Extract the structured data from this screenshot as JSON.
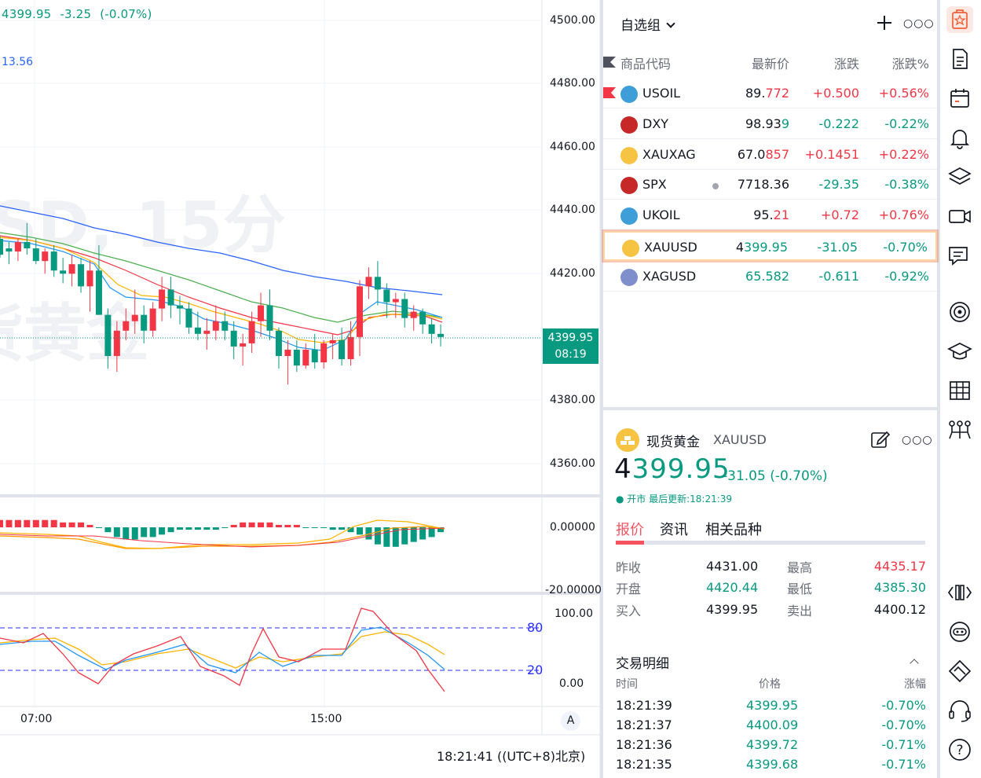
{
  "chart": {
    "header": {
      "price": "4399.95",
      "change": "-3.25",
      "change_pct": "(-0.07%)"
    },
    "ma_label": "13.56",
    "watermark_line1": "SD, 15分",
    "watermark_line2": "货黄金",
    "price_axis": [
      "4500.00",
      "4480.00",
      "4460.00",
      "4440.00",
      "4420.00",
      "4380.00",
      "4360.00"
    ],
    "current_tag": {
      "price": "4399.95",
      "countdown": "08:19"
    },
    "macd_axis": [
      "0.00000",
      "-20.00000"
    ],
    "kd_axis": [
      "100.00",
      "0.00"
    ],
    "kd_levels": [
      "80",
      "20"
    ],
    "time_axis": [
      "07:00",
      "15:00"
    ],
    "auto_label": "A",
    "clock": "18:21:41 ((UTC+8)北京)",
    "colors": {
      "up": "#f23645",
      "down": "#089981",
      "ma_blue": "#2962ff"
    }
  },
  "chart_data": {
    "type": "candlestick",
    "ylim": [
      4350,
      4505
    ],
    "candles": [
      [
        4431,
        4432,
        4425,
        4426
      ],
      [
        4428,
        4430,
        4423,
        4427
      ],
      [
        4427,
        4431,
        4424,
        4430
      ],
      [
        4430,
        4436,
        4426,
        4428
      ],
      [
        4428,
        4431,
        4423,
        4424
      ],
      [
        4424,
        4428,
        4420,
        4427
      ],
      [
        4427,
        4429,
        4419,
        4421
      ],
      [
        4421,
        4425,
        4417,
        4420
      ],
      [
        4420,
        4426,
        4416,
        4423
      ],
      [
        4423,
        4425,
        4414,
        4416
      ],
      [
        4416,
        4424,
        4408,
        4421
      ],
      [
        4421,
        4429,
        4414,
        4407
      ],
      [
        4407,
        4409,
        4390,
        4394
      ],
      [
        4394,
        4405,
        4389,
        4402
      ],
      [
        4402,
        4409,
        4399,
        4405
      ],
      [
        4405,
        4415,
        4401,
        4407
      ],
      [
        4407,
        4410,
        4398,
        4402
      ],
      [
        4402,
        4411,
        4400,
        4409
      ],
      [
        4409,
        4419,
        4405,
        4415
      ],
      [
        4415,
        4419,
        4406,
        4410
      ],
      [
        4410,
        4413,
        4404,
        4409
      ],
      [
        4409,
        4411,
        4401,
        4403
      ],
      [
        4403,
        4408,
        4399,
        4401
      ],
      [
        4401,
        4406,
        4396,
        4402
      ],
      [
        4402,
        4410,
        4399,
        4405
      ],
      [
        4405,
        4408,
        4399,
        4402
      ],
      [
        4402,
        4405,
        4393,
        4397
      ],
      [
        4397,
        4401,
        4391,
        4398
      ],
      [
        4398,
        4408,
        4395,
        4405
      ],
      [
        4405,
        4414,
        4400,
        4410
      ],
      [
        4410,
        4415,
        4399,
        4402
      ],
      [
        4402,
        4403,
        4390,
        4394
      ],
      [
        4394,
        4399,
        4385,
        4396
      ],
      [
        4396,
        4399,
        4389,
        4391
      ],
      [
        4391,
        4398,
        4390,
        4396
      ],
      [
        4396,
        4401,
        4390,
        4392
      ],
      [
        4392,
        4399,
        4390,
        4398
      ],
      [
        4398,
        4401,
        4393,
        4399
      ],
      [
        4399,
        4403,
        4391,
        4393
      ],
      [
        4393,
        4405,
        4391,
        4400
      ],
      [
        4400,
        4418,
        4394,
        4416
      ],
      [
        4416,
        4422,
        4412,
        4419
      ],
      [
        4419,
        4424,
        4410,
        4415
      ],
      [
        4415,
        4417,
        4406,
        4411
      ],
      [
        4411,
        4414,
        4406,
        4412
      ],
      [
        4412,
        4414,
        4403,
        4406
      ],
      [
        4406,
        4410,
        4402,
        4408
      ],
      [
        4408,
        4409,
        4401,
        4404
      ],
      [
        4404,
        4406,
        4398,
        4401
      ],
      [
        4401,
        4404,
        4397,
        4400
      ]
    ]
  },
  "watchlist": {
    "title": "自选组",
    "columns": {
      "symbol": "商品代码",
      "last": "最新价",
      "change": "涨跌",
      "change_pct": "涨跌%"
    },
    "rows": [
      {
        "symbol": "USOIL",
        "last_a": "89.",
        "last_b": "772",
        "change": "+0.500",
        "pct": "+0.56%",
        "dir": "up",
        "icon": "oil-drop-icon",
        "flag": true
      },
      {
        "symbol": "DXY",
        "last_a": "98.93",
        "last_b": "9",
        "change": "-0.222",
        "pct": "-0.22%",
        "dir": "dn",
        "icon": "us-flag-icon"
      },
      {
        "symbol": "XAUXAG",
        "last_a": "67.0",
        "last_b": "857",
        "change": "+0.1451",
        "pct": "+0.22%",
        "dir": "up",
        "icon": "gold-silver-icon"
      },
      {
        "symbol": "SPX",
        "last_a": "7718.36",
        "last_b": "",
        "change": "-29.35",
        "pct": "-0.38%",
        "dir": "dn",
        "icon": "us-flag-icon",
        "dot": true
      },
      {
        "symbol": "UKOIL",
        "last_a": "95.",
        "last_b": "21",
        "change": "+0.72",
        "pct": "+0.76%",
        "dir": "up",
        "icon": "oil-drop-icon"
      },
      {
        "symbol": "XAUUSD",
        "last_a": "4",
        "last_b": "399.95",
        "change": "-31.05",
        "pct": "-0.70%",
        "dir": "dn",
        "icon": "gold-bars-icon",
        "selected": true
      },
      {
        "symbol": "XAGUSD",
        "last_a": "",
        "last_b": "65.582",
        "change": "-0.611",
        "pct": "-0.92%",
        "dir": "dn",
        "icon": "silver-bars-icon"
      }
    ]
  },
  "detail": {
    "name": "现货黄金",
    "code": "XAUUSD",
    "price_first": "4",
    "price_rest": "399.95",
    "change": "-31.05 (-0.70%)",
    "status": "● 开市 最后更新:18:21:39",
    "tabs": [
      "报价",
      "资讯",
      "相关品种"
    ],
    "stats": [
      {
        "label": "昨收",
        "value": "4431.00",
        "label2": "最高",
        "value2": "4435.17"
      },
      {
        "label": "开盘",
        "value": "4420.44",
        "label2": "最低",
        "value2": "4385.30"
      },
      {
        "label": "买入",
        "value": "4399.95",
        "label2": "卖出",
        "value2": "4400.12"
      }
    ],
    "trades_title": "交易明细",
    "trade_headers": [
      "时间",
      "价格",
      "涨幅"
    ],
    "trades": [
      {
        "time": "18:21:39",
        "price": "4399.95",
        "chg": "-0.70%"
      },
      {
        "time": "18:21:37",
        "price": "4400.09",
        "chg": "-0.70%"
      },
      {
        "time": "18:21:36",
        "price": "4399.72",
        "chg": "-0.71%"
      },
      {
        "time": "18:21:35",
        "price": "4399.68",
        "chg": "-0.71%"
      }
    ]
  }
}
